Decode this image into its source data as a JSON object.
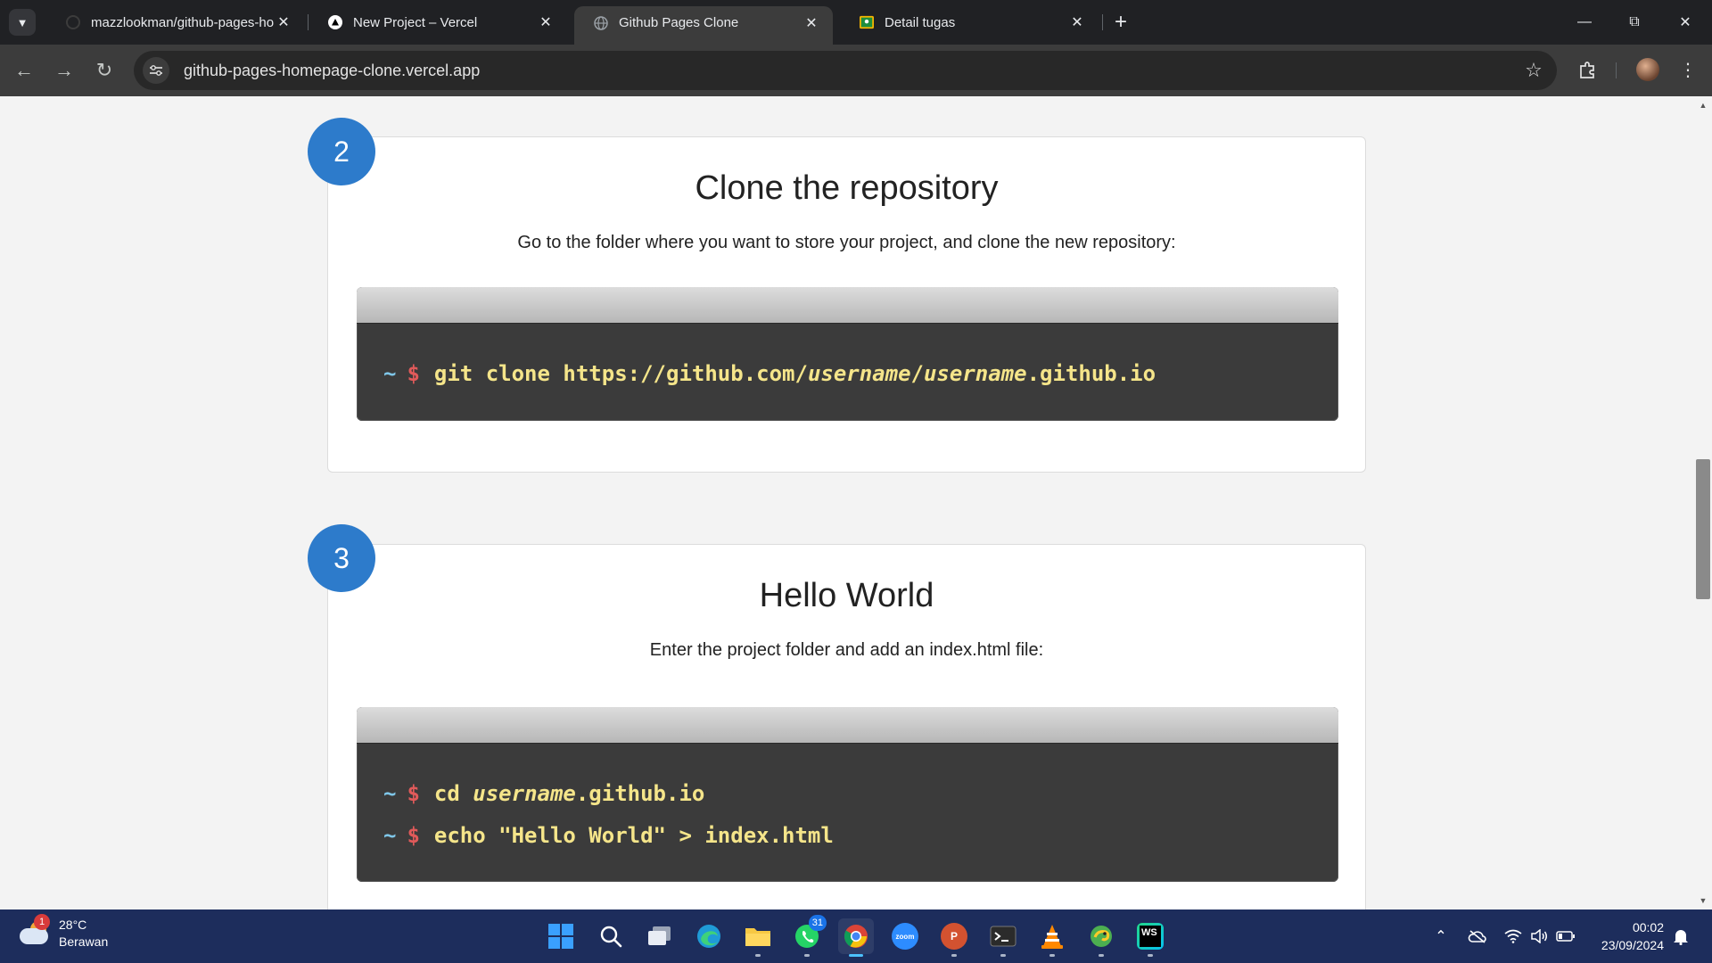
{
  "browser": {
    "tabs": [
      {
        "title": "mazzlookman/github-pages-ho",
        "icon": "github-icon"
      },
      {
        "title": "New Project – Vercel",
        "icon": "vercel-icon"
      },
      {
        "title": "Github Pages Clone",
        "icon": "globe-icon",
        "active": true
      },
      {
        "title": "Detail tugas",
        "icon": "classroom-icon"
      }
    ],
    "address_url": "github-pages-homepage-clone.vercel.app"
  },
  "steps": [
    {
      "number": "2",
      "title": "Clone the repository",
      "description": "Go to the folder where you want to store your project, and clone the new repository:",
      "prompt_tilde": "~",
      "prompt_dollar": "$",
      "commands": [
        {
          "pre": "git clone https://github.com/",
          "em1": "username",
          "mid": "/",
          "em2": "username",
          "post": ".github.io"
        }
      ]
    },
    {
      "number": "3",
      "title": "Hello World",
      "description": "Enter the project folder and add an index.html file:",
      "prompt_tilde": "~",
      "prompt_dollar": "$",
      "commands": [
        {
          "pre": "cd ",
          "em1": "username",
          "post": ".github.io"
        },
        {
          "pre": "echo \"Hello World\" > index.html"
        }
      ]
    }
  ],
  "taskbar": {
    "weather_badge": "1",
    "temperature": "28°C",
    "condition": "Berawan",
    "whatsapp_badge": "31",
    "zoom_label": "zoom",
    "powerpoint_label": "P",
    "webstorm_label": "WS",
    "time": "00:02",
    "date": "23/09/2024"
  },
  "colors": {
    "step_badge": "#2d7bcb",
    "terminal_bg": "#3b3b3b",
    "terminal_text": "#f5e58a",
    "prompt_tilde": "#7fc6e8",
    "prompt_dollar": "#e05a5a",
    "taskbar_bg": "#1d2d5c"
  }
}
